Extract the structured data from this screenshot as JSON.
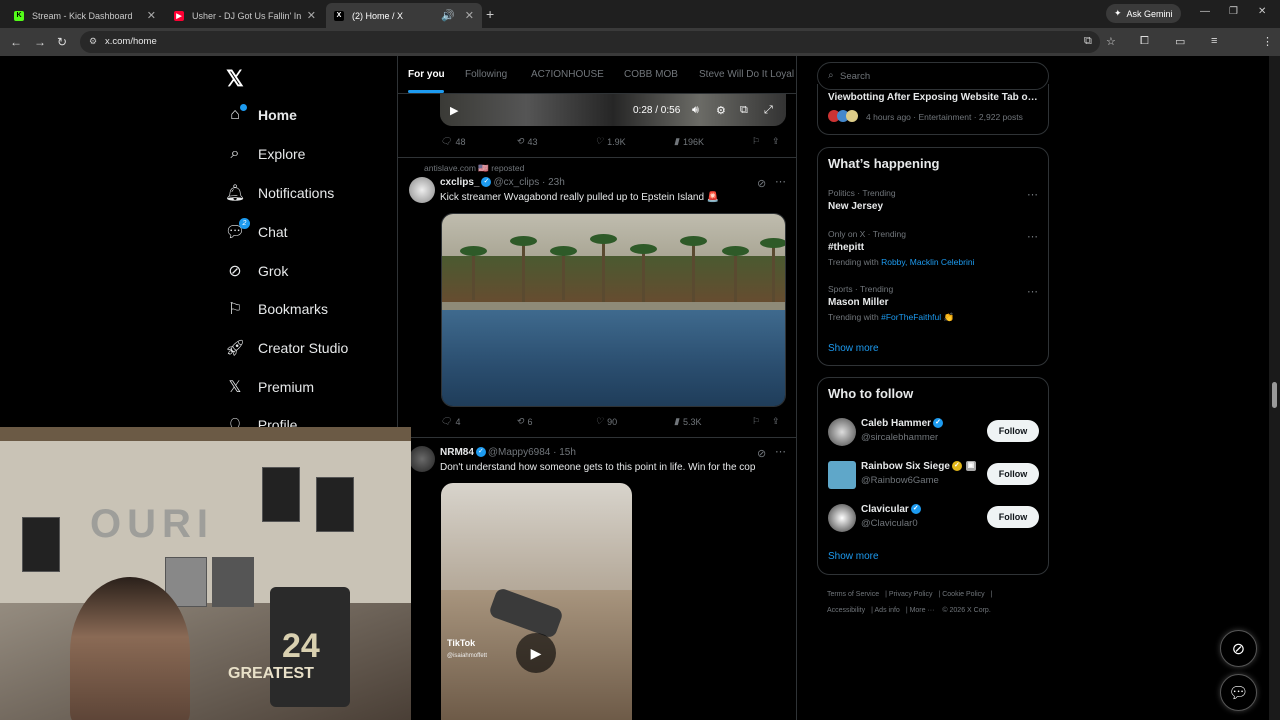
{
  "browser": {
    "tabs": [
      {
        "title": "Stream - Kick Dashboard",
        "fav": "K",
        "favcolor": "#53fc18"
      },
      {
        "title": "Usher - DJ Got Us Fallin' In Love",
        "fav": "▶",
        "favcolor": "#ff0033"
      },
      {
        "title": "(2) Home / X",
        "fav": "X",
        "favcolor": "#ffffff"
      }
    ],
    "ask_gemini": "Ask Gemini",
    "url": "x.com/home"
  },
  "nav": {
    "items": [
      {
        "label": "Home",
        "icon": "home-icon"
      },
      {
        "label": "Explore",
        "icon": "search-icon"
      },
      {
        "label": "Notifications",
        "icon": "bell-icon"
      },
      {
        "label": "Chat",
        "icon": "chat-icon",
        "badge": "2"
      },
      {
        "label": "Grok",
        "icon": "grok-icon"
      },
      {
        "label": "Bookmarks",
        "icon": "bookmark-icon"
      },
      {
        "label": "Creator Studio",
        "icon": "rocket-icon"
      },
      {
        "label": "Premium",
        "icon": "x-icon"
      },
      {
        "label": "Profile",
        "icon": "person-icon"
      }
    ]
  },
  "feed": {
    "tabs": [
      "For you",
      "Following",
      "AC7IONHOUSE",
      "COBB MOB",
      "Steve Will Do It Loyal"
    ],
    "video": {
      "time": "0:28 / 0:56"
    },
    "post0": {
      "replies": "48",
      "reposts": "43",
      "likes": "1.9K",
      "views": "196K"
    },
    "post1": {
      "repost_by": "antislave.com 🇺🇸 reposted",
      "name": "cxclips_",
      "handle": "@cx_clips · 23h",
      "text": "Kick streamer Wvagabond really pulled up to Epstein Island 🚨",
      "replies": "4",
      "reposts": "6",
      "likes": "90",
      "views": "5.3K"
    },
    "post2": {
      "name": "NRM84",
      "handle": "@Mappy6984 · 15h",
      "text": "Don't understand how someone gets to this point in life. Win for the cop",
      "tiktok": "TikTok",
      "tiktok_handle": "@isaiahmoffett"
    }
  },
  "sidebar": {
    "search_placeholder": "Search",
    "top_trend": {
      "title": "Viewbotting After Exposing Website Tab o…",
      "meta": "4 hours ago · Entertainment · 2,922 posts"
    },
    "whats_happening": {
      "title": "What’s happening",
      "trends": [
        {
          "context": "Politics · Trending",
          "name": "New Jersey",
          "extra_prefix": "",
          "extra_link": ""
        },
        {
          "context": "Only on X · Trending",
          "name": "#thepitt",
          "extra_prefix": "Trending with",
          "extra_link": "Robby, Macklin Celebrini"
        },
        {
          "context": "Sports · Trending",
          "name": "Mason Miller",
          "extra_prefix": "Trending with",
          "extra_link": "#ForTheFaithful 👏"
        }
      ],
      "show_more": "Show more"
    },
    "who_to_follow": {
      "title": "Who to follow",
      "users": [
        {
          "name": "Caleb Hammer",
          "handle": "@sircalebhammer",
          "button": "Follow"
        },
        {
          "name": "Rainbow Six Siege",
          "handle": "@Rainbow6Game",
          "button": "Follow"
        },
        {
          "name": "Clavicular",
          "handle": "@Clavicular0",
          "button": "Follow"
        }
      ],
      "show_more": "Show more"
    },
    "footer": [
      "Terms of Service",
      "Privacy Policy",
      "Cookie Policy",
      "Accessibility",
      "Ads info",
      "More ···",
      "© 2026 X Corp."
    ]
  },
  "webcam": {
    "sign": "OURI",
    "jersey": "24",
    "shirt": "GREATEST"
  }
}
